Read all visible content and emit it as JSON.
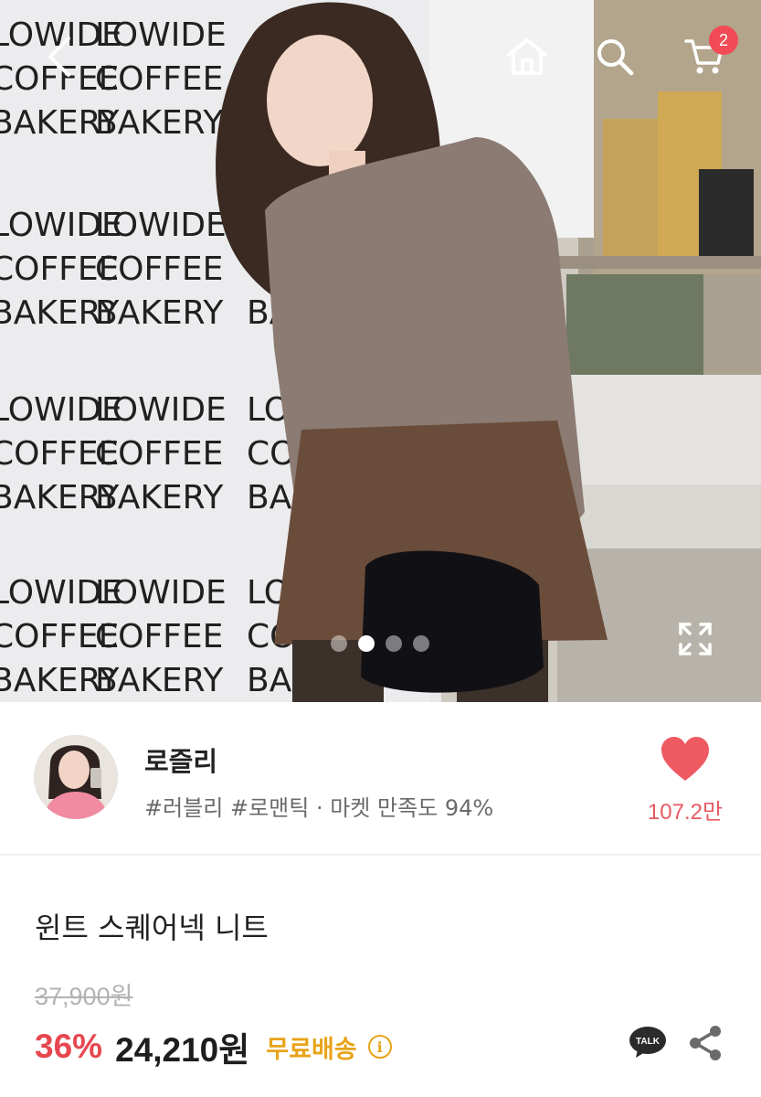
{
  "hero": {
    "wall_text_lines": [
      "LOWIDE",
      "COFFEE",
      "BAKERY"
    ],
    "carousel": {
      "slide_count": 4,
      "active_index": 1
    }
  },
  "header": {
    "icons": [
      "back-arrow-icon",
      "home-icon",
      "search-icon",
      "cart-icon"
    ],
    "cart_badge": "2"
  },
  "seller": {
    "name": "로즐리",
    "tags": "#러블리 #로맨틱 · 마켓 만족도 94%",
    "like_count": "107.2만"
  },
  "product": {
    "title": "윈트 스퀘어넥 니트",
    "original_price": "37,900원",
    "discount": "36%",
    "sale_price": "24,210원",
    "shipping": "무료배송",
    "info_icon": "i",
    "talk_label": "TALK"
  },
  "colors": {
    "badge": "#f04b57",
    "heart": "#ef5a62",
    "discount": "#e6474f",
    "shipping": "#e8a418",
    "talk_bubble": "#2b2b2b"
  }
}
